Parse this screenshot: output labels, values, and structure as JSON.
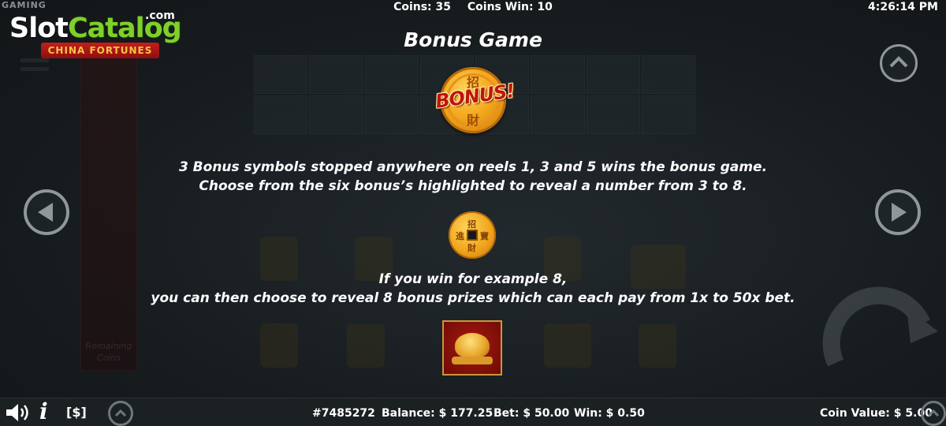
{
  "top_bar": {
    "brand": "GAMING",
    "coins": "Coins: 35",
    "coins_win": "Coins Win: 10",
    "clock": "4:26:14 PM"
  },
  "watermark": {
    "slot": "Slot",
    "catalog": "Catalog",
    "dotcom": ".com",
    "game_name": "CHINA FORTUNES"
  },
  "background": {
    "remaining_coins_label": "Remaining Coins"
  },
  "paytable": {
    "title": "Bonus Game",
    "bonus_symbol_text": "BONUS!",
    "paragraph1_line1": "3 Bonus symbols stopped anywhere on reels 1, 3 and 5 wins the bonus game.",
    "paragraph1_line2": "Choose from the six bonus’s highlighted to reveal a number from 3 to 8.",
    "paragraph2_line1": "If you win for example 8,",
    "paragraph2_line2": "you can then choose to reveal 8 bonus prizes which can each pay from 1x to 50x bet."
  },
  "bottom_bar": {
    "cash_label": "[$]",
    "info_label": "i",
    "game_id": "#7485272",
    "balance": "Balance: $ 177.25",
    "bet": "Bet: $ 50.00",
    "win": "Win: $ 0.50",
    "coin_value": "Coin Value: $ 5.00"
  },
  "icons": {
    "sound": "speaker-icon",
    "info": "info-icon",
    "prev": "arrow-left-icon",
    "next": "arrow-right-icon",
    "up": "chevron-up-icon",
    "spin": "spin-icon"
  },
  "colors": {
    "catalog_green": "#7fd02a",
    "gold": "#f3a81d",
    "bonus_red": "#c0140e"
  }
}
